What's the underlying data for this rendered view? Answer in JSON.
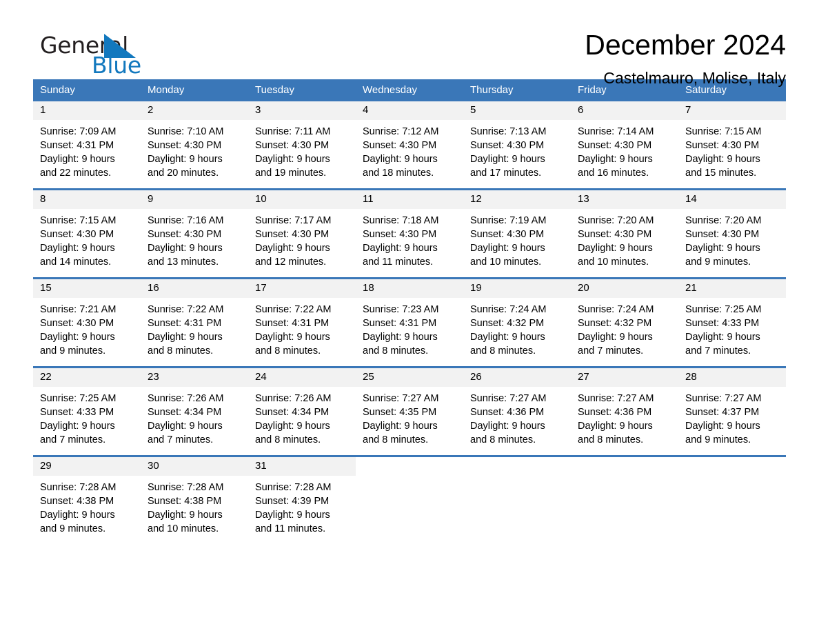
{
  "brand": {
    "name_part1": "General",
    "name_part2": "Blue",
    "triangle_color": "#1278be",
    "text_color": "#231f20"
  },
  "header": {
    "title": "December 2024",
    "subtitle": "Castelmauro, Molise, Italy"
  },
  "theme": {
    "header_blue": "#3a77b8",
    "daynum_strip": "#f2f2f2",
    "cell_background": "#ffffff"
  },
  "weekdays": [
    "Sunday",
    "Monday",
    "Tuesday",
    "Wednesday",
    "Thursday",
    "Friday",
    "Saturday"
  ],
  "weeks": [
    [
      {
        "day": "1",
        "sunrise": "Sunrise: 7:09 AM",
        "sunset": "Sunset: 4:31 PM",
        "daylight1": "Daylight: 9 hours",
        "daylight2": "and 22 minutes."
      },
      {
        "day": "2",
        "sunrise": "Sunrise: 7:10 AM",
        "sunset": "Sunset: 4:30 PM",
        "daylight1": "Daylight: 9 hours",
        "daylight2": "and 20 minutes."
      },
      {
        "day": "3",
        "sunrise": "Sunrise: 7:11 AM",
        "sunset": "Sunset: 4:30 PM",
        "daylight1": "Daylight: 9 hours",
        "daylight2": "and 19 minutes."
      },
      {
        "day": "4",
        "sunrise": "Sunrise: 7:12 AM",
        "sunset": "Sunset: 4:30 PM",
        "daylight1": "Daylight: 9 hours",
        "daylight2": "and 18 minutes."
      },
      {
        "day": "5",
        "sunrise": "Sunrise: 7:13 AM",
        "sunset": "Sunset: 4:30 PM",
        "daylight1": "Daylight: 9 hours",
        "daylight2": "and 17 minutes."
      },
      {
        "day": "6",
        "sunrise": "Sunrise: 7:14 AM",
        "sunset": "Sunset: 4:30 PM",
        "daylight1": "Daylight: 9 hours",
        "daylight2": "and 16 minutes."
      },
      {
        "day": "7",
        "sunrise": "Sunrise: 7:15 AM",
        "sunset": "Sunset: 4:30 PM",
        "daylight1": "Daylight: 9 hours",
        "daylight2": "and 15 minutes."
      }
    ],
    [
      {
        "day": "8",
        "sunrise": "Sunrise: 7:15 AM",
        "sunset": "Sunset: 4:30 PM",
        "daylight1": "Daylight: 9 hours",
        "daylight2": "and 14 minutes."
      },
      {
        "day": "9",
        "sunrise": "Sunrise: 7:16 AM",
        "sunset": "Sunset: 4:30 PM",
        "daylight1": "Daylight: 9 hours",
        "daylight2": "and 13 minutes."
      },
      {
        "day": "10",
        "sunrise": "Sunrise: 7:17 AM",
        "sunset": "Sunset: 4:30 PM",
        "daylight1": "Daylight: 9 hours",
        "daylight2": "and 12 minutes."
      },
      {
        "day": "11",
        "sunrise": "Sunrise: 7:18 AM",
        "sunset": "Sunset: 4:30 PM",
        "daylight1": "Daylight: 9 hours",
        "daylight2": "and 11 minutes."
      },
      {
        "day": "12",
        "sunrise": "Sunrise: 7:19 AM",
        "sunset": "Sunset: 4:30 PM",
        "daylight1": "Daylight: 9 hours",
        "daylight2": "and 10 minutes."
      },
      {
        "day": "13",
        "sunrise": "Sunrise: 7:20 AM",
        "sunset": "Sunset: 4:30 PM",
        "daylight1": "Daylight: 9 hours",
        "daylight2": "and 10 minutes."
      },
      {
        "day": "14",
        "sunrise": "Sunrise: 7:20 AM",
        "sunset": "Sunset: 4:30 PM",
        "daylight1": "Daylight: 9 hours",
        "daylight2": "and 9 minutes."
      }
    ],
    [
      {
        "day": "15",
        "sunrise": "Sunrise: 7:21 AM",
        "sunset": "Sunset: 4:30 PM",
        "daylight1": "Daylight: 9 hours",
        "daylight2": "and 9 minutes."
      },
      {
        "day": "16",
        "sunrise": "Sunrise: 7:22 AM",
        "sunset": "Sunset: 4:31 PM",
        "daylight1": "Daylight: 9 hours",
        "daylight2": "and 8 minutes."
      },
      {
        "day": "17",
        "sunrise": "Sunrise: 7:22 AM",
        "sunset": "Sunset: 4:31 PM",
        "daylight1": "Daylight: 9 hours",
        "daylight2": "and 8 minutes."
      },
      {
        "day": "18",
        "sunrise": "Sunrise: 7:23 AM",
        "sunset": "Sunset: 4:31 PM",
        "daylight1": "Daylight: 9 hours",
        "daylight2": "and 8 minutes."
      },
      {
        "day": "19",
        "sunrise": "Sunrise: 7:24 AM",
        "sunset": "Sunset: 4:32 PM",
        "daylight1": "Daylight: 9 hours",
        "daylight2": "and 8 minutes."
      },
      {
        "day": "20",
        "sunrise": "Sunrise: 7:24 AM",
        "sunset": "Sunset: 4:32 PM",
        "daylight1": "Daylight: 9 hours",
        "daylight2": "and 7 minutes."
      },
      {
        "day": "21",
        "sunrise": "Sunrise: 7:25 AM",
        "sunset": "Sunset: 4:33 PM",
        "daylight1": "Daylight: 9 hours",
        "daylight2": "and 7 minutes."
      }
    ],
    [
      {
        "day": "22",
        "sunrise": "Sunrise: 7:25 AM",
        "sunset": "Sunset: 4:33 PM",
        "daylight1": "Daylight: 9 hours",
        "daylight2": "and 7 minutes."
      },
      {
        "day": "23",
        "sunrise": "Sunrise: 7:26 AM",
        "sunset": "Sunset: 4:34 PM",
        "daylight1": "Daylight: 9 hours",
        "daylight2": "and 7 minutes."
      },
      {
        "day": "24",
        "sunrise": "Sunrise: 7:26 AM",
        "sunset": "Sunset: 4:34 PM",
        "daylight1": "Daylight: 9 hours",
        "daylight2": "and 8 minutes."
      },
      {
        "day": "25",
        "sunrise": "Sunrise: 7:27 AM",
        "sunset": "Sunset: 4:35 PM",
        "daylight1": "Daylight: 9 hours",
        "daylight2": "and 8 minutes."
      },
      {
        "day": "26",
        "sunrise": "Sunrise: 7:27 AM",
        "sunset": "Sunset: 4:36 PM",
        "daylight1": "Daylight: 9 hours",
        "daylight2": "and 8 minutes."
      },
      {
        "day": "27",
        "sunrise": "Sunrise: 7:27 AM",
        "sunset": "Sunset: 4:36 PM",
        "daylight1": "Daylight: 9 hours",
        "daylight2": "and 8 minutes."
      },
      {
        "day": "28",
        "sunrise": "Sunrise: 7:27 AM",
        "sunset": "Sunset: 4:37 PM",
        "daylight1": "Daylight: 9 hours",
        "daylight2": "and 9 minutes."
      }
    ],
    [
      {
        "day": "29",
        "sunrise": "Sunrise: 7:28 AM",
        "sunset": "Sunset: 4:38 PM",
        "daylight1": "Daylight: 9 hours",
        "daylight2": "and 9 minutes."
      },
      {
        "day": "30",
        "sunrise": "Sunrise: 7:28 AM",
        "sunset": "Sunset: 4:38 PM",
        "daylight1": "Daylight: 9 hours",
        "daylight2": "and 10 minutes."
      },
      {
        "day": "31",
        "sunrise": "Sunrise: 7:28 AM",
        "sunset": "Sunset: 4:39 PM",
        "daylight1": "Daylight: 9 hours",
        "daylight2": "and 11 minutes."
      },
      {
        "day": "",
        "sunrise": "",
        "sunset": "",
        "daylight1": "",
        "daylight2": "",
        "empty": true
      },
      {
        "day": "",
        "sunrise": "",
        "sunset": "",
        "daylight1": "",
        "daylight2": "",
        "empty": true
      },
      {
        "day": "",
        "sunrise": "",
        "sunset": "",
        "daylight1": "",
        "daylight2": "",
        "empty": true
      },
      {
        "day": "",
        "sunrise": "",
        "sunset": "",
        "daylight1": "",
        "daylight2": "",
        "empty": true
      }
    ]
  ]
}
